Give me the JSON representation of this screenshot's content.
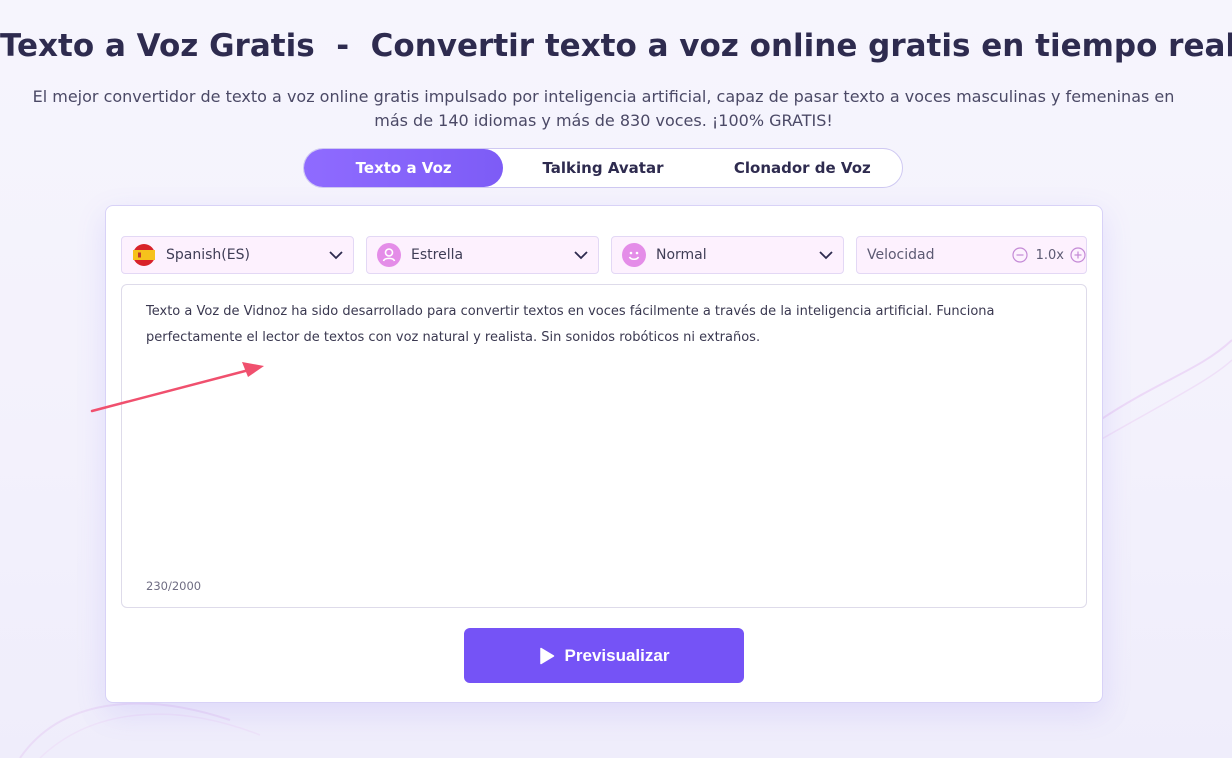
{
  "header": {
    "title": "Texto a Voz Gratis  -  Convertir texto a voz online gratis en tiempo real",
    "subtitle": "El mejor convertidor de texto a voz online gratis impulsado por inteligencia artificial, capaz de pasar texto a voces masculinas y femeninas en más de 140 idiomas y más de 830 voces. ¡100% GRATIS!"
  },
  "tabs": [
    {
      "label": "Texto a Voz",
      "active": true
    },
    {
      "label": "Talking Avatar",
      "active": false
    },
    {
      "label": "Clonador de Voz",
      "active": false
    }
  ],
  "controls": {
    "language": {
      "value": "Spanish(ES)",
      "icon": "spain-flag-icon"
    },
    "voice": {
      "value": "Estrella",
      "icon": "person-icon"
    },
    "emotion": {
      "value": "Normal",
      "icon": "smiley-icon"
    },
    "speed": {
      "label": "Velocidad",
      "value": "1.0x"
    }
  },
  "editor": {
    "text": "Texto a Voz de Vidnoz ha sido desarrollado para convertir textos en voces fácilmente a través de la inteligencia artificial. Funciona perfectamente el lector de textos con voz natural y realista. Sin sonidos robóticos ni extraños.",
    "counter": "230/2000"
  },
  "actions": {
    "preview_label": "Previsualizar"
  },
  "colors": {
    "accent": "#7553f6",
    "tab_active": "#8f6bff",
    "select_bg": "#fdf1fe",
    "annotation_arrow": "#f0506e"
  }
}
